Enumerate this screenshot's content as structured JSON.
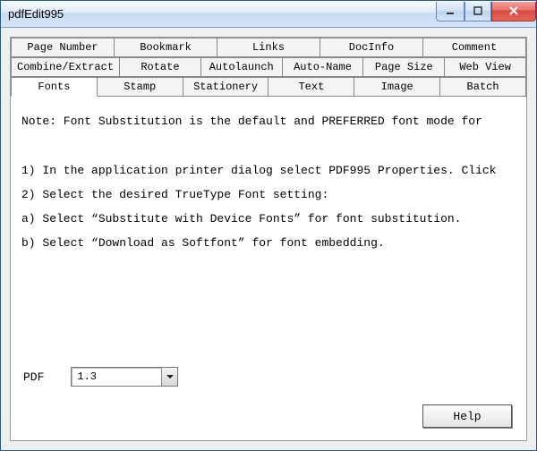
{
  "window": {
    "title": "pdfEdit995"
  },
  "tabs": {
    "row1": [
      "Page Number",
      "Bookmark",
      "Links",
      "DocInfo",
      "Comment"
    ],
    "row2": [
      "Combine/Extract",
      "Rotate",
      "Autolaunch",
      "Auto-Name",
      "Page Size",
      "Web View"
    ],
    "row3": [
      "Fonts",
      "Stamp",
      "Stationery",
      "Text",
      "Image",
      "Batch"
    ],
    "active": "Fonts"
  },
  "content": {
    "note": "Note: Font Substitution is the default and PREFERRED font mode for",
    "step1": "1) In the application printer dialog select PDF995 Properties. Click",
    "step2": "2) Select the desired TrueType Font setting:",
    "optA": "a) Select “Substitute with Device Fonts” for font substitution.",
    "optB": "b) Select “Download as Softfont” for font embedding."
  },
  "pdf": {
    "label": "PDF",
    "value": "1.3"
  },
  "buttons": {
    "help": "Help"
  }
}
